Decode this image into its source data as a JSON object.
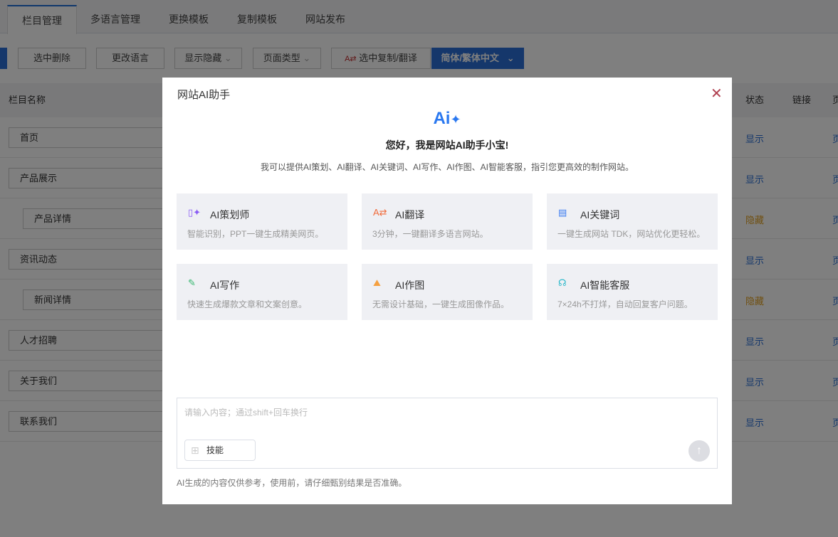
{
  "tabs": [
    "栏目管理",
    "多语言管理",
    "更换模板",
    "复制模板",
    "网站发布"
  ],
  "toolbar": {
    "delete": "选中删除",
    "language": "更改语言",
    "show_hide": "显示隐藏",
    "page_type": "页面类型",
    "copy_translate": "选中复制/翻译",
    "lang_select": "简体/繁体中文"
  },
  "table": {
    "headers": {
      "name": "栏目名称",
      "status": "状态",
      "link": "链接",
      "page": "页"
    },
    "rows": [
      {
        "name": "首页",
        "status": "显示",
        "page": "页",
        "child": false
      },
      {
        "name": "产品展示",
        "status": "显示",
        "page": "页",
        "child": false
      },
      {
        "name": "产品详情",
        "status": "隐藏",
        "page": "页",
        "child": true
      },
      {
        "name": "资讯动态",
        "status": "显示",
        "page": "页",
        "child": false
      },
      {
        "name": "新闻详情",
        "status": "隐藏",
        "page": "页",
        "child": true
      },
      {
        "name": "人才招聘",
        "status": "显示",
        "page": "页",
        "child": false
      },
      {
        "name": "关于我们",
        "status": "显示",
        "page": "页",
        "child": false
      },
      {
        "name": "联系我们",
        "status": "显示",
        "page": "页",
        "child": false
      }
    ]
  },
  "modal": {
    "title": "网站AI助手",
    "logo": "Ai",
    "greeting": "您好，我是网站AI助手小宝!",
    "description": "我可以提供AI策划、AI翻译、AI关键词、AI写作、AI作图、AI智能客服，指引您更高效的制作网站。",
    "cards": [
      {
        "title": "AI策划师",
        "desc": "智能识别，PPT一键生成精美网页。",
        "icon": "planner-icon",
        "color": "#8a5cf5"
      },
      {
        "title": "AI翻译",
        "desc": "3分钟，一键翻译多语言网站。",
        "icon": "translate-icon",
        "color": "#f06a3a"
      },
      {
        "title": "AI关键词",
        "desc": "一键生成网站 TDK，网站优化更轻松。",
        "icon": "keyword-icon",
        "color": "#3a7bf0"
      },
      {
        "title": "AI写作",
        "desc": "快速生成爆款文章和文案创意。",
        "icon": "writing-icon",
        "color": "#2fb56a"
      },
      {
        "title": "AI作图",
        "desc": "无需设计基础，一键生成图像作品。",
        "icon": "image-icon",
        "color": "#f5a040"
      },
      {
        "title": "AI智能客服",
        "desc": "7×24h不打烊，自动回复客户问题。",
        "icon": "headset-icon",
        "color": "#25b7c9"
      }
    ],
    "input_placeholder": "请输入内容；通过shift+回车换行",
    "skill_label": "技能",
    "disclaimer": "AI生成的内容仅供参考，使用前，请仔细甄别结果是否准确。"
  },
  "colors": {
    "accent": "#1e6fd9",
    "show": "#2a6fd6",
    "hidden": "#e0a020"
  }
}
